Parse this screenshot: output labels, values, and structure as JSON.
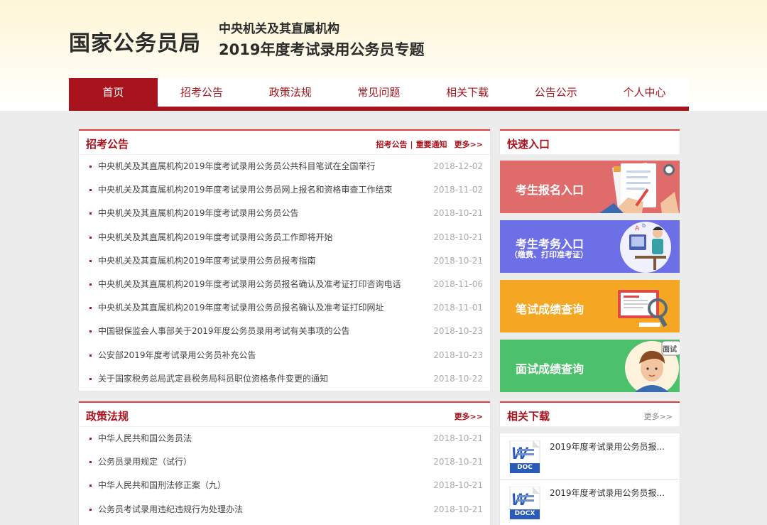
{
  "header": {
    "logo": "国家公务员局",
    "subtitle_line1": "中央机关及其直属机构",
    "subtitle_line2": "2019年度考试录用公务员专题"
  },
  "nav": {
    "items": [
      "首页",
      "招考公告",
      "政策法规",
      "常见问题",
      "相关下载",
      "公告公示",
      "个人中心"
    ],
    "active_index": 0
  },
  "recruit": {
    "title": "招考公告",
    "link1": "招考公告",
    "link_sep": "|",
    "link2": "重要通知",
    "more": "更多>>",
    "items": [
      {
        "text": "中央机关及其直属机构2019年度考试录用公务员公共科目笔试在全国举行",
        "date": "2018-12-02"
      },
      {
        "text": "中央机关及其直属机构2019年度考试录用公务员网上报名和资格审查工作结束",
        "date": "2018-11-02"
      },
      {
        "text": "中央机关及其直属机构2019年度考试录用公务员公告",
        "date": "2018-10-21"
      },
      {
        "text": "中央机关及其直属机构2019年度考试录用公务员工作即将开始",
        "date": "2018-10-21"
      },
      {
        "text": "中央机关及其直属机构2019年度考试录用公务员报考指南",
        "date": "2018-10-21"
      },
      {
        "text": "中央机关及其直属机构2019年度考试录用公务员报名确认及准考证打印咨询电话",
        "date": "2018-11-06"
      },
      {
        "text": "中央机关及其直属机构2019年度考试录用公务员报名确认及准考证打印网址",
        "date": "2018-11-01"
      },
      {
        "text": "中国银保监会人事部关于2019年度公务员录用考试有关事项的公告",
        "date": "2018-10-23"
      },
      {
        "text": "公安部2019年度考试录用公务员补充公告",
        "date": "2018-10-23"
      },
      {
        "text": "关于国家税务总局武定县税务局科员职位资格条件变更的通知",
        "date": "2018-10-22"
      }
    ]
  },
  "policy": {
    "title": "政策法规",
    "more": "更多>>",
    "items": [
      {
        "text": "中华人民共和国公务员法",
        "date": "2018-10-21"
      },
      {
        "text": "公务员录用规定（试行）",
        "date": "2018-10-21"
      },
      {
        "text": "中华人民共和国刑法修正案（九）",
        "date": "2018-10-21"
      },
      {
        "text": "公务员考试录用违纪违规行为处理办法",
        "date": "2018-10-21"
      }
    ]
  },
  "quick": {
    "title": "快速入口",
    "entries": [
      {
        "label": "考生报名入口",
        "color": "#e06b6b"
      },
      {
        "label": "考生考务入口",
        "sub": "（缴费、打印准考证）",
        "color": "#6d6fe6"
      },
      {
        "label": "笔试成绩查询",
        "color": "#f5a623"
      },
      {
        "label": "面试成绩查询",
        "color": "#4cc06b"
      }
    ],
    "interview_badge": "面试"
  },
  "downloads": {
    "title": "相关下载",
    "more": "更多>>",
    "items": [
      {
        "text": "2019年度考试录用公务员报...",
        "type": "DOC"
      },
      {
        "text": "2019年度考试录用公务员报...",
        "type": "DOCX"
      }
    ]
  },
  "colors": {
    "brand": "#a8141e",
    "accent": "#d94040"
  }
}
